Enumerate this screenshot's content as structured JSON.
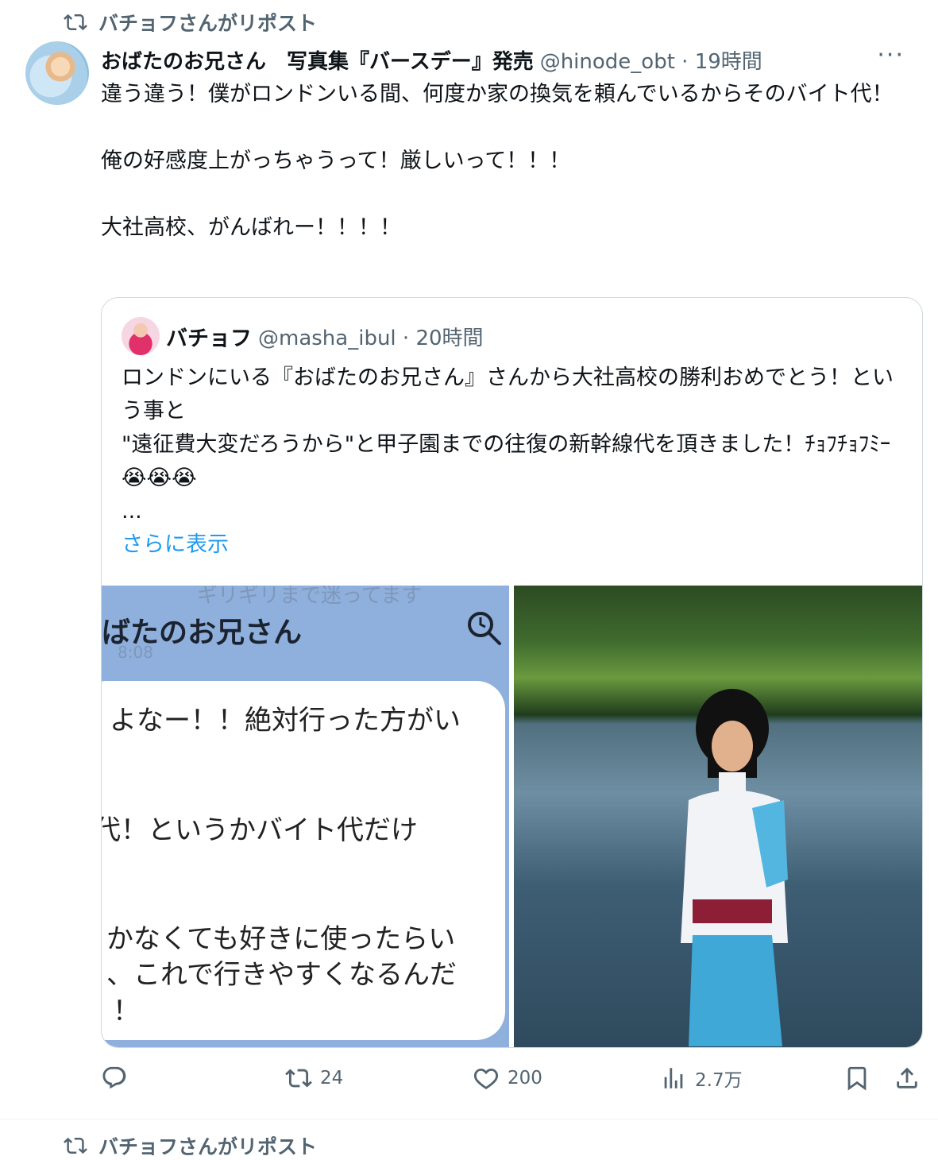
{
  "repost_header": {
    "text": "バチョフさんがリポスト"
  },
  "tweet": {
    "display_name": "おばたのお兄さん　写真集『バースデー』発売",
    "handle": "@hinode_obt · 19時間",
    "more_label": "···",
    "paragraphs": [
      "違う違う！僕がロンドンいる間、何度か家の換気を頼んでいるからそのバイト代！",
      "俺の好感度上がっちゃうって！厳しいって！！！",
      "大社高校、がんばれー！！！！"
    ]
  },
  "quote": {
    "display_name": "バチョフ",
    "handle": "@masha_ibul · 20時間",
    "lines": [
      "ロンドンにいる『おばたのお兄さん』さんから大社高校の勝利おめでとう！という事と",
      "\"遠征費大変だろうから\"と甲子園までの往復の新幹線代を頂きました！ﾁｮﾌﾁｮﾌﾐｰ😭😭😭",
      "..."
    ],
    "show_more": "さらに表示",
    "screenshot": {
      "top_text": "ギリギリまで迷ってます",
      "title": "ばたのお兄さん",
      "sub": "8:08",
      "lines": [
        "よなー！！絶対行った方がい",
        "代！というかバイト代だけ",
        "",
        "かなくても好きに使ったらい",
        "、これで行きやすくなるんだ",
        "！"
      ]
    }
  },
  "actions": {
    "reply_count": "",
    "retweet_count": "24",
    "like_count": "200",
    "views_count": "2.7万"
  },
  "next_repost": {
    "text": "バチョフさんがリポスト"
  }
}
